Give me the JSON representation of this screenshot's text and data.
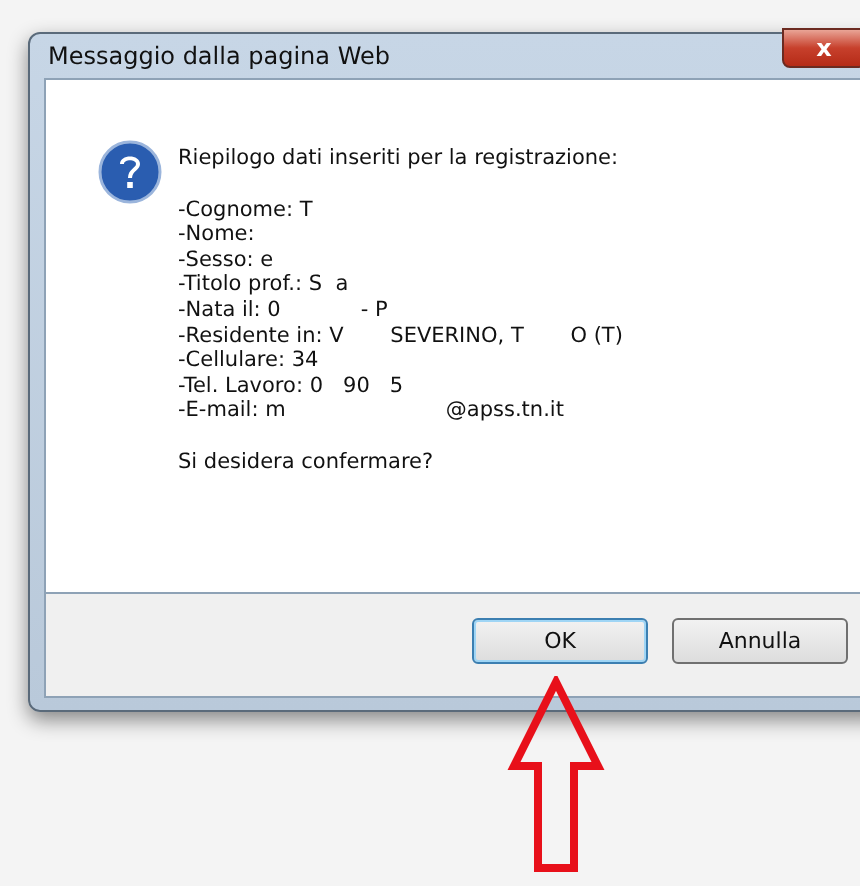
{
  "window": {
    "title": "Messaggio dalla pagina Web",
    "close": "x"
  },
  "message": {
    "heading": "Riepilogo dati inseriti per la registrazione:",
    "lines": [
      {
        "label": "-Cognome:",
        "value": "T"
      },
      {
        "label": "-Nome:"
      },
      {
        "label": "-Sesso:",
        "value": "e"
      },
      {
        "label": "-Titolo prof.:",
        "value": "S  a"
      },
      {
        "label": "-Nata il:",
        "value": "0            - P"
      },
      {
        "label": "-Residente in:",
        "value": "V       SEVERINO, T       O (T)"
      },
      {
        "label": "-Cellulare:",
        "value": "34"
      },
      {
        "label": "-Tel. Lavoro:",
        "value": "0   90   5"
      },
      {
        "label": "-E-mail:",
        "value": "m                        @apss.tn.it"
      }
    ],
    "question": "Si desidera confermare?"
  },
  "buttons": [
    {
      "label": "OK",
      "selected": true
    },
    {
      "label": "Annulla",
      "selected": false
    }
  ]
}
